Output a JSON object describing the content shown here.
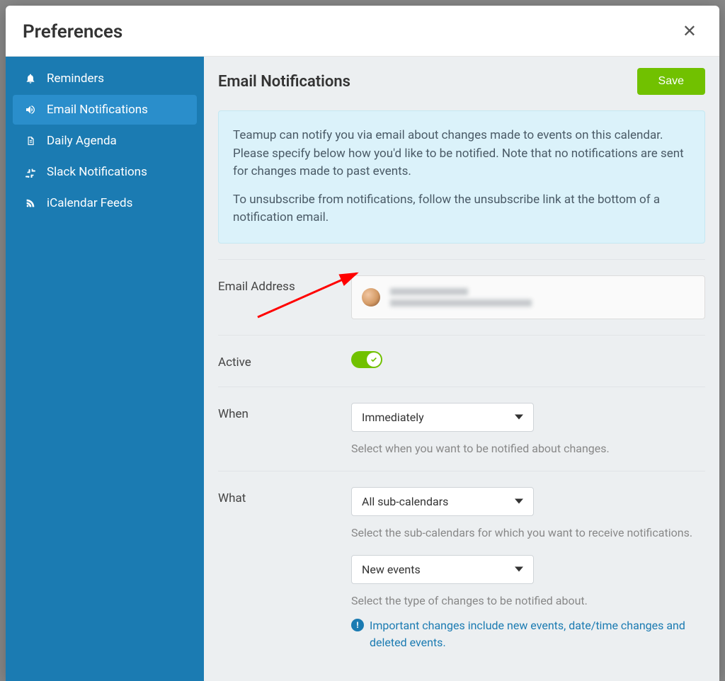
{
  "modal": {
    "title": "Preferences",
    "close_label": "✕"
  },
  "sidebar": {
    "items": [
      {
        "label": "Reminders"
      },
      {
        "label": "Email Notifications"
      },
      {
        "label": "Daily Agenda"
      },
      {
        "label": "Slack Notifications"
      },
      {
        "label": "iCalendar Feeds"
      }
    ]
  },
  "content": {
    "title": "Email Notifications",
    "save_label": "Save",
    "info_p1": "Teamup can notify you via email about changes made to events on this calendar. Please specify below how you'd like to be notified. Note that no notifications are sent for changes made to past events.",
    "info_p2": "To unsubscribe from notifications, follow the unsubscribe link at the bottom of a notification email.",
    "email_label": "Email Address",
    "active_label": "Active",
    "when": {
      "label": "When",
      "selected": "Immediately",
      "hint": "Select when you want to be notified about changes."
    },
    "what": {
      "label": "What",
      "selected_calendars": "All sub-calendars",
      "hint_calendars": "Select the sub-calendars for which you want to receive notifications.",
      "selected_changes": "New events",
      "hint_changes": "Select the type of changes to be notified about.",
      "note": "Important changes include new events, date/time changes and deleted events."
    }
  }
}
